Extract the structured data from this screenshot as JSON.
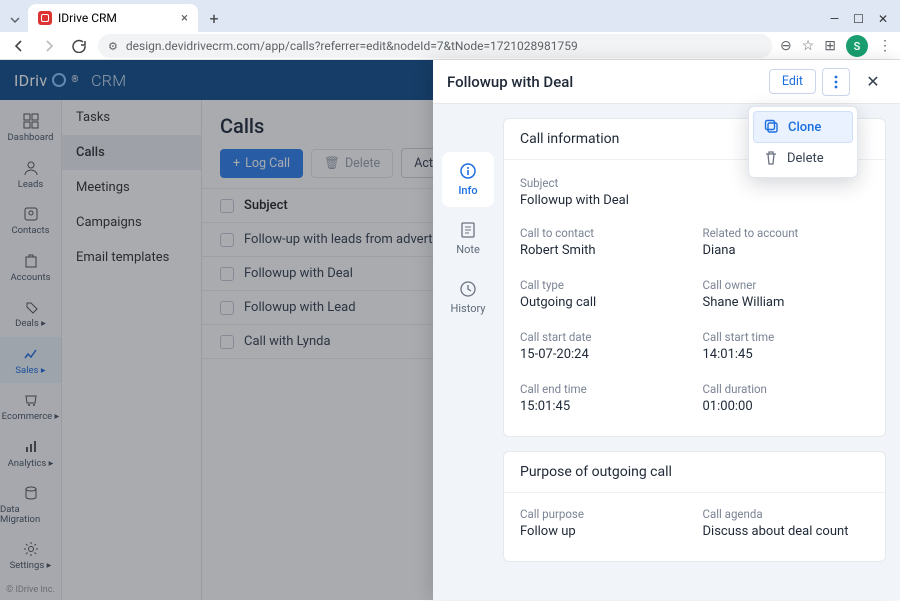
{
  "browser": {
    "tab_title": "IDrive CRM",
    "url": "design.devidrivecrm.com/app/calls?referrer=edit&nodeId=7&tNode=1721028981759",
    "avatar_letter": "S"
  },
  "brand": {
    "left": "IDriv",
    "right": "CRM",
    "reg": "®"
  },
  "iconbar": [
    {
      "label": "Dashboard"
    },
    {
      "label": "Leads"
    },
    {
      "label": "Contacts"
    },
    {
      "label": "Accounts"
    },
    {
      "label": "Deals ▸"
    },
    {
      "label": "Sales ▸"
    },
    {
      "label": "Ecommerce ▸"
    },
    {
      "label": "Analytics ▸"
    },
    {
      "label": "Data Migration"
    },
    {
      "label": "Settings ▸"
    }
  ],
  "iconbar_active_index": 5,
  "footer_text": "© IDrive Inc.",
  "subnav": [
    "Tasks",
    "Calls",
    "Meetings",
    "Campaigns",
    "Email templates"
  ],
  "subnav_active_index": 1,
  "main": {
    "title": "Calls",
    "log_call": "Log Call",
    "delete": "Delete",
    "actions": "Actions",
    "col_subject": "Subject",
    "rows": [
      "Follow-up with leads from advertisement",
      "Followup with Deal",
      "Followup with Lead",
      "Call with Lynda"
    ]
  },
  "drawer": {
    "title": "Followup with Deal",
    "edit": "Edit",
    "tabs": {
      "info": "Info",
      "note": "Note",
      "history": "History"
    },
    "menu": {
      "clone": "Clone",
      "delete": "Delete"
    },
    "call_info_title": "Call information",
    "purpose_title": "Purpose of outgoing call",
    "fields": {
      "subject_l": "Subject",
      "subject_v": "Followup with Deal",
      "contact_l": "Call to contact",
      "contact_v": "Robert Smith",
      "account_l": "Related to account",
      "account_v": "Diana",
      "type_l": "Call type",
      "type_v": "Outgoing call",
      "owner_l": "Call owner",
      "owner_v": "Shane William",
      "sdate_l": "Call start date",
      "sdate_v": "15-07-20:24",
      "stime_l": "Call start time",
      "stime_v": "14:01:45",
      "etime_l": "Call end time",
      "etime_v": "15:01:45",
      "dur_l": "Call duration",
      "dur_v": "01:00:00",
      "purpose_l": "Call purpose",
      "purpose_v": "Follow up",
      "agenda_l": "Call agenda",
      "agenda_v": "Discuss about deal count"
    }
  }
}
